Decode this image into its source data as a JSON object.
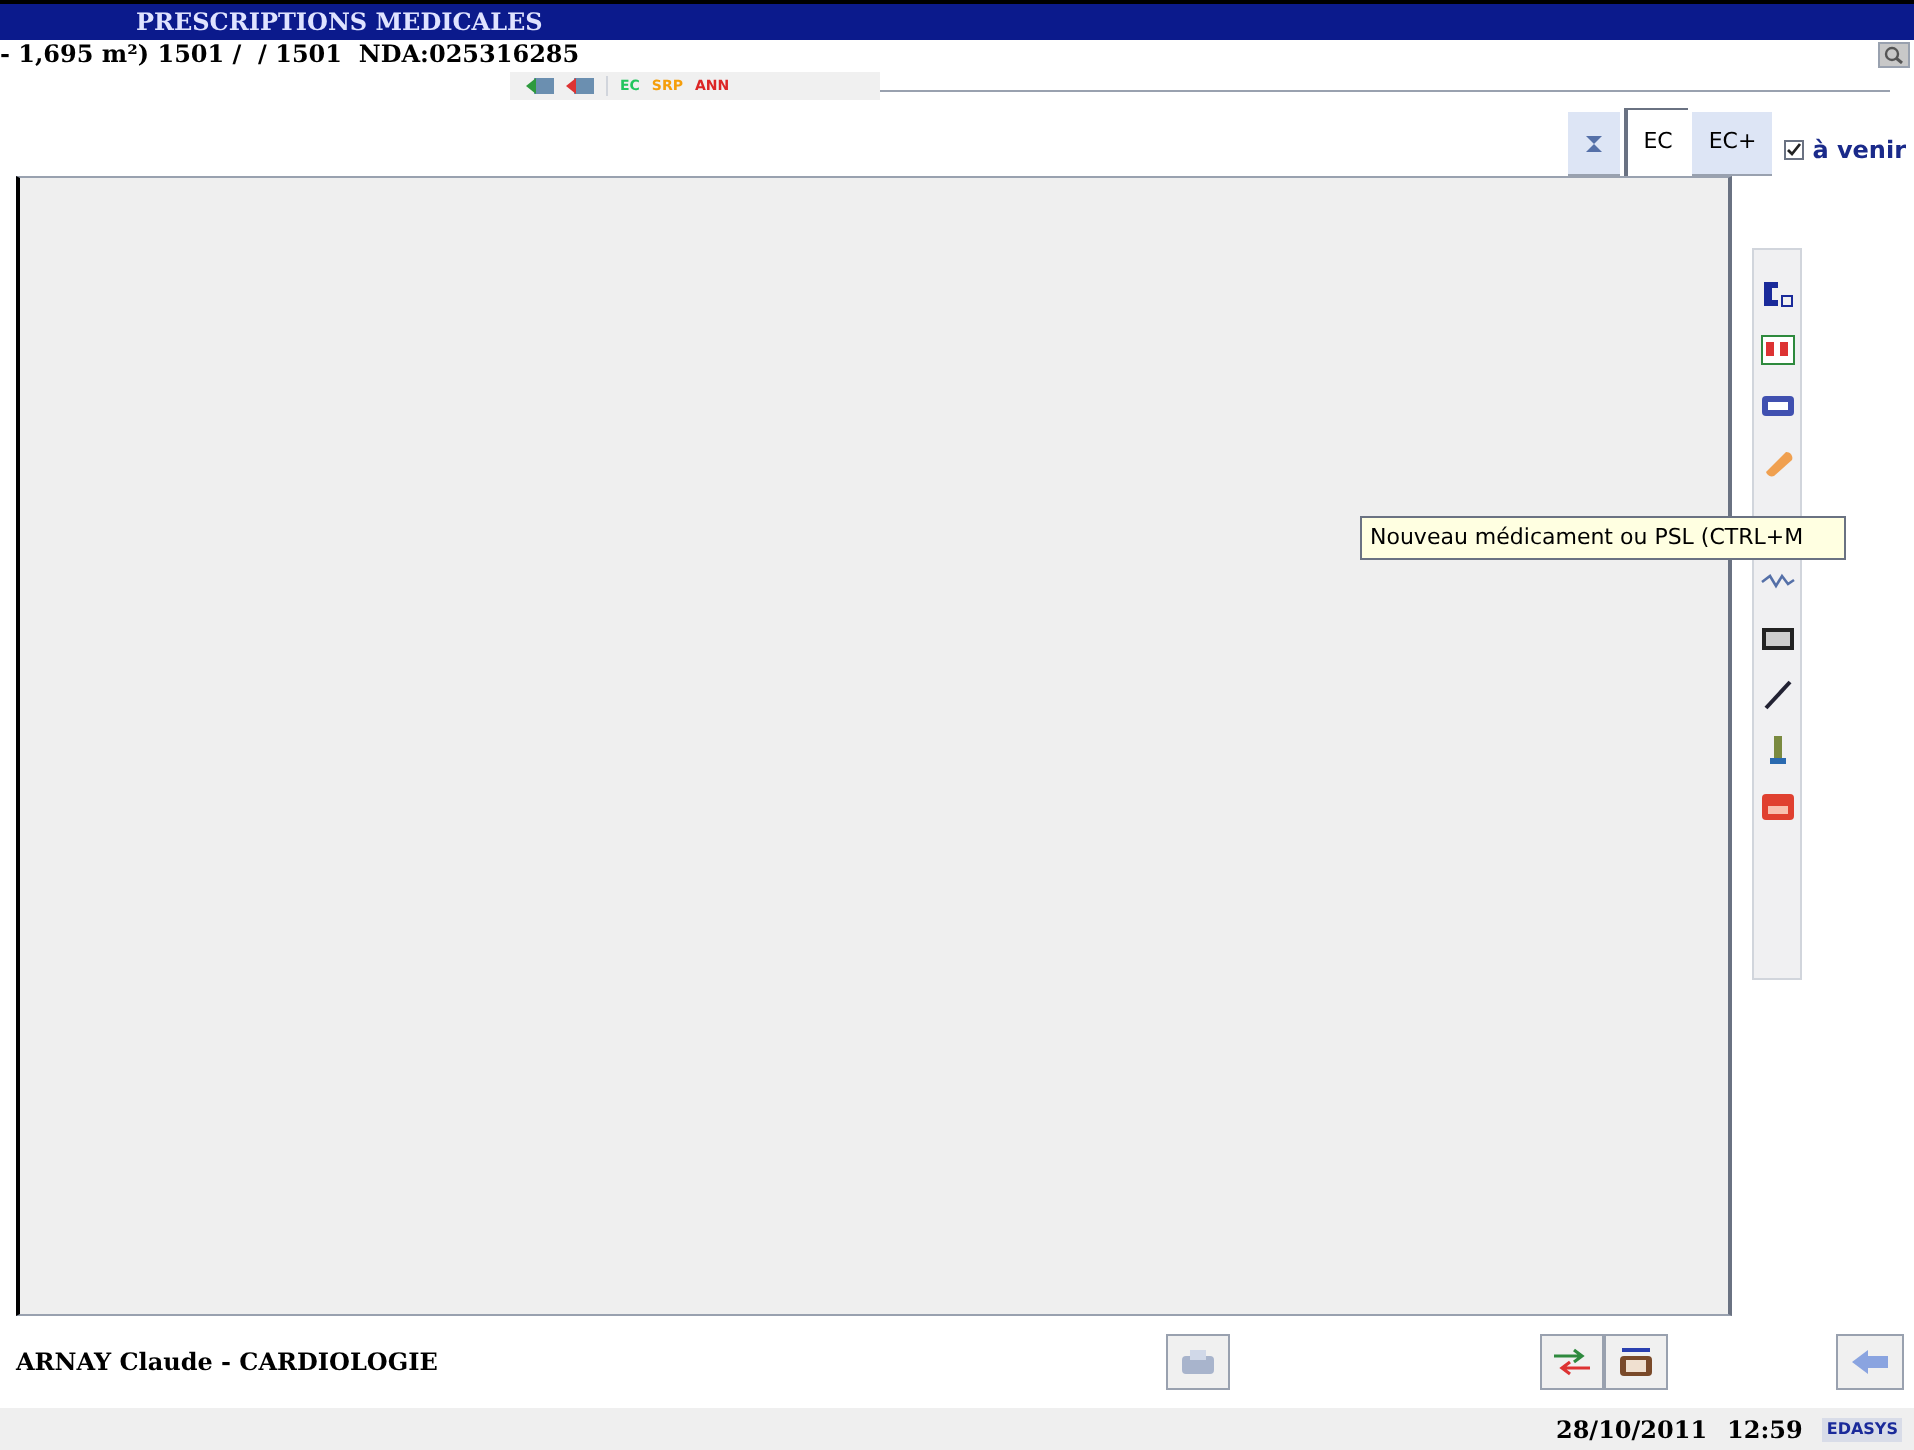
{
  "window": {
    "title": "PRESCRIPTIONS MEDICALES"
  },
  "patient_line": "- 1,695 m²) 1501 /  / 1501  NDA:025316285",
  "toolbar": {
    "labels": [
      {
        "text": "EC",
        "color": "#22c55e"
      },
      {
        "text": "SRP",
        "color": "#f59e0b"
      },
      {
        "text": "ANN",
        "color": "#dc2626"
      }
    ]
  },
  "tabs": [
    {
      "kind": "icon",
      "selected": false
    },
    {
      "kind": "text",
      "label": "EC",
      "selected": true
    },
    {
      "kind": "text",
      "label": "EC+",
      "selected": false
    }
  ],
  "upcoming": {
    "label": "à venir",
    "checked": true
  },
  "tooltip": "Nouveau médicament ou PSL (CTRL+M",
  "footer": {
    "doctor": "ARNAY Claude - CARDIOLOGIE"
  },
  "status_bar": {
    "date": "28/10/2011",
    "time": "12:59",
    "logo": "EDASYS"
  }
}
